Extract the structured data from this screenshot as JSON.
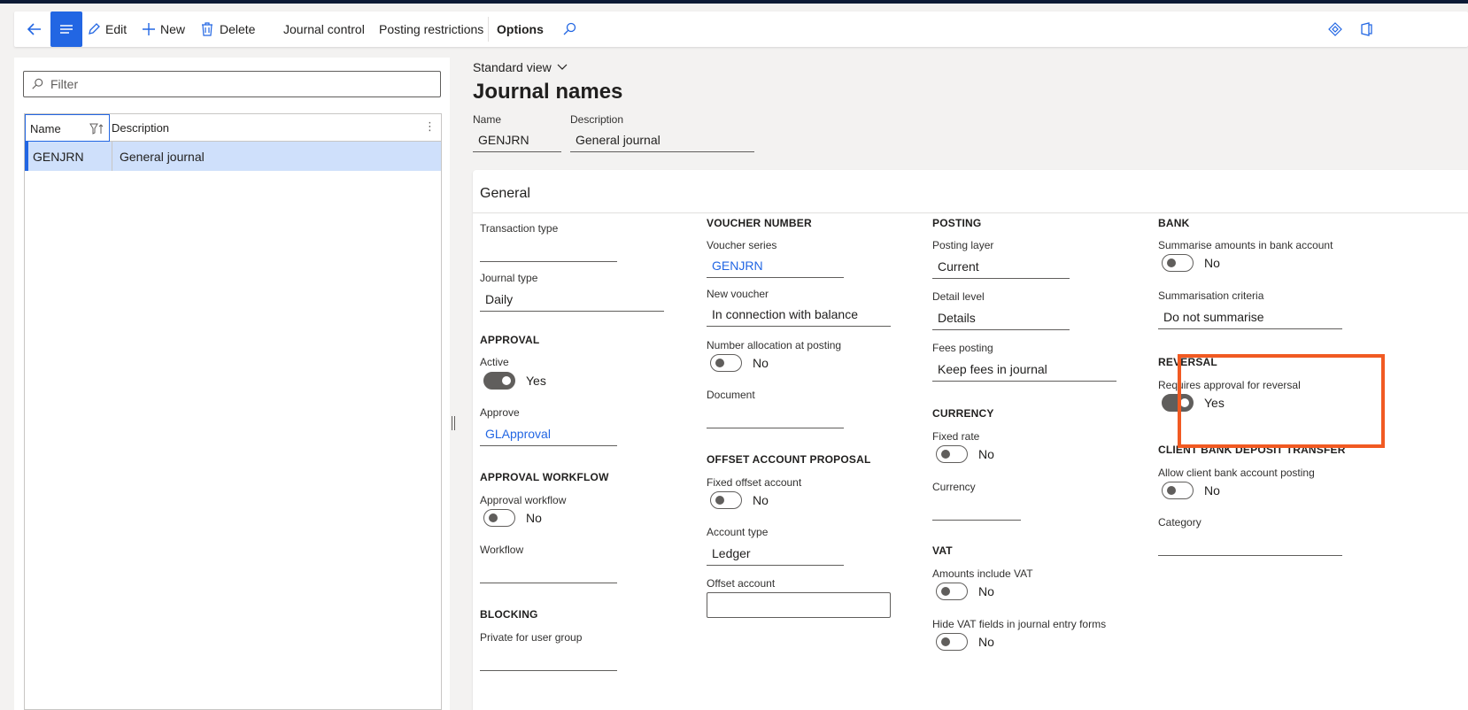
{
  "actions": {
    "edit": "Edit",
    "new": "New",
    "delete": "Delete",
    "journal_control": "Journal control",
    "posting_restrictions": "Posting restrictions",
    "options": "Options"
  },
  "leftpane": {
    "filter_placeholder": "Filter",
    "columns": [
      "Name",
      "Description"
    ],
    "rows": [
      {
        "name": "GENJRN",
        "description": "General journal"
      }
    ]
  },
  "main": {
    "view": "Standard view",
    "title": "Journal names",
    "name_label": "Name",
    "name_value": "GENJRN",
    "desc_label": "Description",
    "desc_value": "General journal"
  },
  "general": {
    "title": "General",
    "col1": {
      "transaction_type_label": "Transaction type",
      "transaction_type_value": "",
      "journal_type_label": "Journal type",
      "journal_type_value": "Daily",
      "approval_header": "APPROVAL",
      "active_label": "Active",
      "active_value": "Yes",
      "approve_label": "Approve",
      "approve_value": "GLApproval",
      "approval_workflow_header": "APPROVAL WORKFLOW",
      "approval_workflow_label": "Approval workflow",
      "approval_workflow_value": "No",
      "workflow_label": "Workflow",
      "blocking_header": "BLOCKING",
      "private_label": "Private for user group"
    },
    "col2": {
      "voucher_header": "VOUCHER NUMBER",
      "voucher_series_label": "Voucher series",
      "voucher_series_value": "GENJRN",
      "new_voucher_label": "New voucher",
      "new_voucher_value": "In connection with balance",
      "number_alloc_label": "Number allocation at posting",
      "number_alloc_value": "No",
      "document_label": "Document",
      "offset_header": "OFFSET ACCOUNT PROPOSAL",
      "fixed_offset_label": "Fixed offset account",
      "fixed_offset_value": "No",
      "account_type_label": "Account type",
      "account_type_value": "Ledger",
      "offset_account_label": "Offset account"
    },
    "col3": {
      "posting_header": "POSTING",
      "posting_layer_label": "Posting layer",
      "posting_layer_value": "Current",
      "detail_level_label": "Detail level",
      "detail_level_value": "Details",
      "fees_label": "Fees posting",
      "fees_value": "Keep fees in journal",
      "currency_header": "CURRENCY",
      "fixed_rate_label": "Fixed rate",
      "fixed_rate_value": "No",
      "currency_label": "Currency",
      "vat_header": "VAT",
      "amounts_vat_label": "Amounts include VAT",
      "amounts_vat_value": "No",
      "hide_vat_label": "Hide VAT fields in journal entry forms",
      "hide_vat_value": "No"
    },
    "col4": {
      "bank_header": "BANK",
      "summarise_label": "Summarise amounts in bank account",
      "summarise_value": "No",
      "criteria_label": "Summarisation criteria",
      "criteria_value": "Do not summarise",
      "reversal_header": "REVERSAL",
      "reversal_label": "Requires approval for reversal",
      "reversal_value": "Yes",
      "client_header": "CLIENT BANK DEPOSIT TRANSFER",
      "client_label": "Allow client bank account posting",
      "client_value": "No",
      "category_label": "Category"
    }
  },
  "colors": {
    "accent": "#2266e3",
    "highlight": "#f15a22"
  }
}
